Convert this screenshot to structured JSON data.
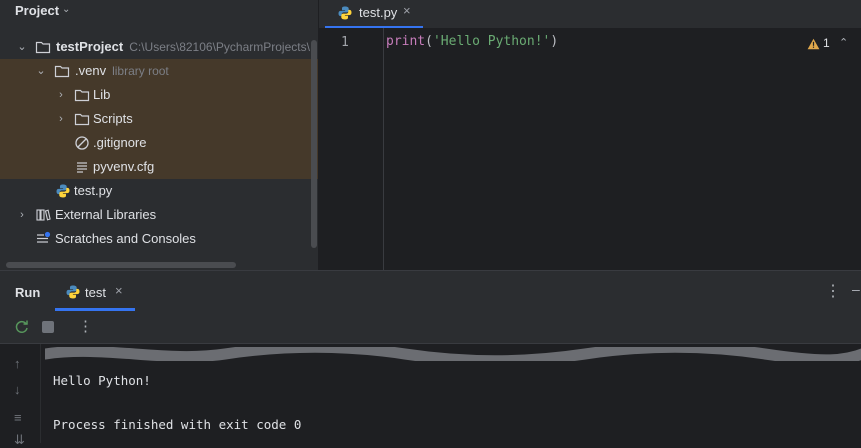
{
  "project_panel": {
    "title": "Project",
    "tree": [
      {
        "label": "testProject",
        "hint": "C:\\Users\\82106\\PycharmProjects\\",
        "icon": "folder-icon",
        "chevron": "expanded"
      },
      {
        "label": ".venv",
        "hint": "library root",
        "icon": "folder-icon",
        "chevron": "expanded"
      },
      {
        "label": "Lib",
        "icon": "folder-icon",
        "chevron": "collapsed"
      },
      {
        "label": "Scripts",
        "icon": "folder-icon",
        "chevron": "collapsed"
      },
      {
        "label": ".gitignore",
        "icon": "ignored-file-icon"
      },
      {
        "label": "pyvenv.cfg",
        "icon": "config-file-icon"
      },
      {
        "label": "test.py",
        "icon": "python-file-icon"
      },
      {
        "label": "External Libraries",
        "icon": "library-icon",
        "chevron": "collapsed"
      },
      {
        "label": "Scratches and Consoles",
        "icon": "scratches-icon"
      }
    ]
  },
  "editor": {
    "tab_label": "test.py",
    "line_number": "1",
    "code": {
      "fn": "print",
      "open": "(",
      "str": "'Hello Python!'",
      "close": ")"
    },
    "warning_count": "1"
  },
  "run_panel": {
    "title": "Run",
    "tab_label": "test",
    "console": {
      "line_output": "Hello Python!",
      "line_exit": "Process finished with exit code 0"
    }
  },
  "colors": {
    "accent": "#3574f0",
    "venv_highlight": "#45392a",
    "string": "#6aab73",
    "keyword": "#c77dbb",
    "warning": "#e0a84c"
  }
}
